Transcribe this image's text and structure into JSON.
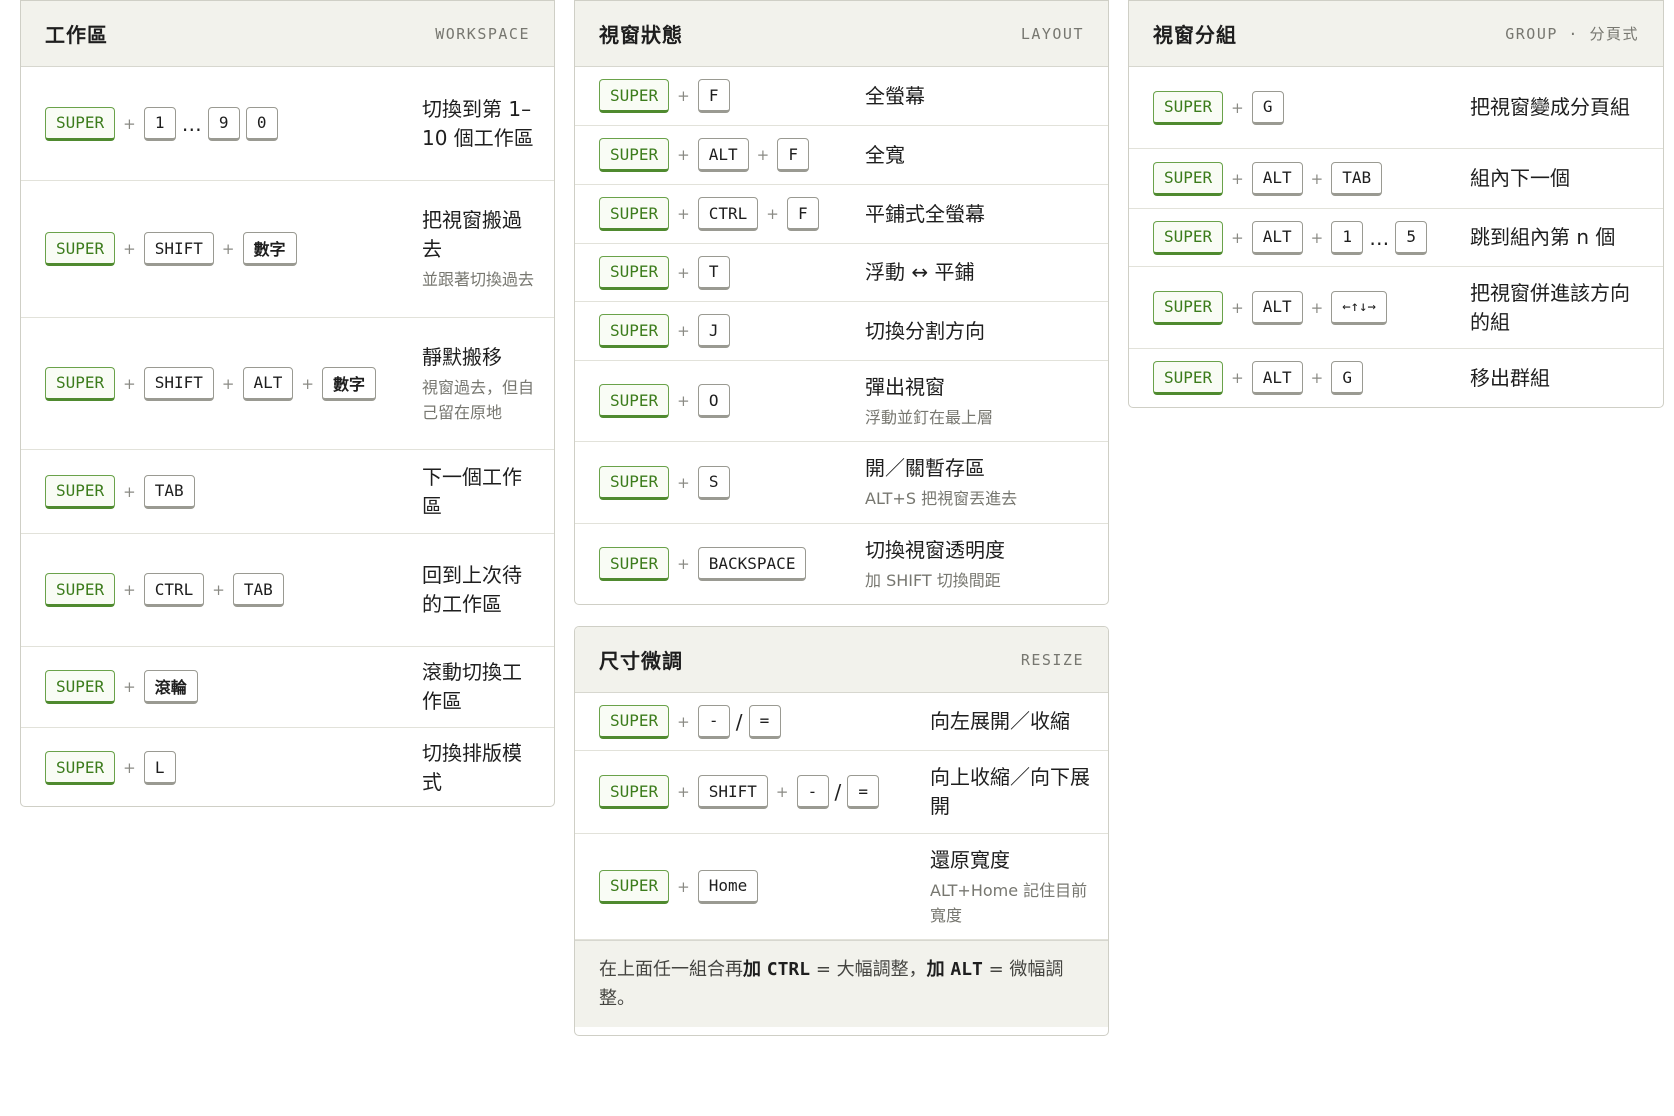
{
  "workspace": {
    "title": "工作區",
    "tag": "WORKSPACE",
    "rows": [
      {
        "keys": [
          "SUPER",
          "1",
          "…",
          "9",
          "0"
        ],
        "desc": "切換到第 1–10 個工作區",
        "sub": ""
      },
      {
        "keys": [
          "SUPER",
          "SHIFT",
          "數字"
        ],
        "desc": "把視窗搬過去",
        "sub": "並跟著切換過去"
      },
      {
        "keys": [
          "SUPER",
          "SHIFT",
          "ALT",
          "數字"
        ],
        "desc": "靜默搬移",
        "sub": "視窗過去，但自己留在原地"
      },
      {
        "keys": [
          "SUPER",
          "TAB"
        ],
        "desc": "下一個工作區",
        "sub": ""
      },
      {
        "keys": [
          "SUPER",
          "CTRL",
          "TAB"
        ],
        "desc": "回到上次待的工作區",
        "sub": ""
      },
      {
        "keys": [
          "SUPER",
          "滾輪"
        ],
        "desc": "滾動切換工作區",
        "sub": ""
      },
      {
        "keys": [
          "SUPER",
          "L"
        ],
        "desc": "切換排版模式",
        "sub": ""
      }
    ]
  },
  "layout": {
    "title": "視窗狀態",
    "tag": "LAYOUT",
    "rows": [
      {
        "keys": [
          "SUPER",
          "F"
        ],
        "desc": "全螢幕",
        "sub": ""
      },
      {
        "keys": [
          "SUPER",
          "ALT",
          "F"
        ],
        "desc": "全寬",
        "sub": ""
      },
      {
        "keys": [
          "SUPER",
          "CTRL",
          "F"
        ],
        "desc": "平鋪式全螢幕",
        "sub": ""
      },
      {
        "keys": [
          "SUPER",
          "T"
        ],
        "desc": "浮動 ↔ 平鋪",
        "sub": ""
      },
      {
        "keys": [
          "SUPER",
          "J"
        ],
        "desc": "切換分割方向",
        "sub": ""
      },
      {
        "keys": [
          "SUPER",
          "O"
        ],
        "desc": "彈出視窗",
        "sub": "浮動並釘在最上層"
      },
      {
        "keys": [
          "SUPER",
          "S"
        ],
        "desc": "開／關暫存區",
        "sub": "ALT+S 把視窗丟進去"
      },
      {
        "keys": [
          "SUPER",
          "BACKSPACE"
        ],
        "desc": "切換視窗透明度",
        "sub": "加 SHIFT 切換間距"
      }
    ]
  },
  "resize": {
    "title": "尺寸微調",
    "tag": "RESIZE",
    "rows": [
      {
        "keys": [
          "SUPER",
          "-",
          "="
        ],
        "desc": "向左展開／收縮",
        "sub": ""
      },
      {
        "keys": [
          "SUPER",
          "SHIFT",
          "-",
          "="
        ],
        "desc": "向上收縮／向下展開",
        "sub": ""
      },
      {
        "keys": [
          "SUPER",
          "Home"
        ],
        "desc": "還原寬度",
        "sub": "ALT+Home 記住目前寬度"
      }
    ],
    "note": {
      "part1": "在上面任一組合再",
      "plus1": "加",
      "mod1": "CTRL",
      "part2": " = 大幅調整，",
      "plus2": "加",
      "mod2": "ALT",
      "part3": " = 微幅調整。"
    }
  },
  "group": {
    "title": "視窗分組",
    "tag": "GROUP · 分頁式",
    "rows": [
      {
        "keys": [
          "SUPER",
          "G"
        ],
        "desc": "把視窗變成分頁組",
        "sub": ""
      },
      {
        "keys": [
          "SUPER",
          "ALT",
          "TAB"
        ],
        "desc": "組內下一個",
        "sub": ""
      },
      {
        "keys": [
          "SUPER",
          "ALT",
          "1",
          "…",
          "5"
        ],
        "desc": "跳到組內第 n 個",
        "sub": ""
      },
      {
        "keys": [
          "SUPER",
          "ALT",
          "←↑↓→"
        ],
        "desc": "把視窗併進該方向的組",
        "sub": ""
      },
      {
        "keys": [
          "SUPER",
          "ALT",
          "G"
        ],
        "desc": "移出群組",
        "sub": ""
      }
    ]
  },
  "colors": {
    "super_key": "#3c7c1c",
    "super_border": "#6aa24a",
    "header_bg": "#f2f2ec",
    "muted_text": "#777770"
  }
}
